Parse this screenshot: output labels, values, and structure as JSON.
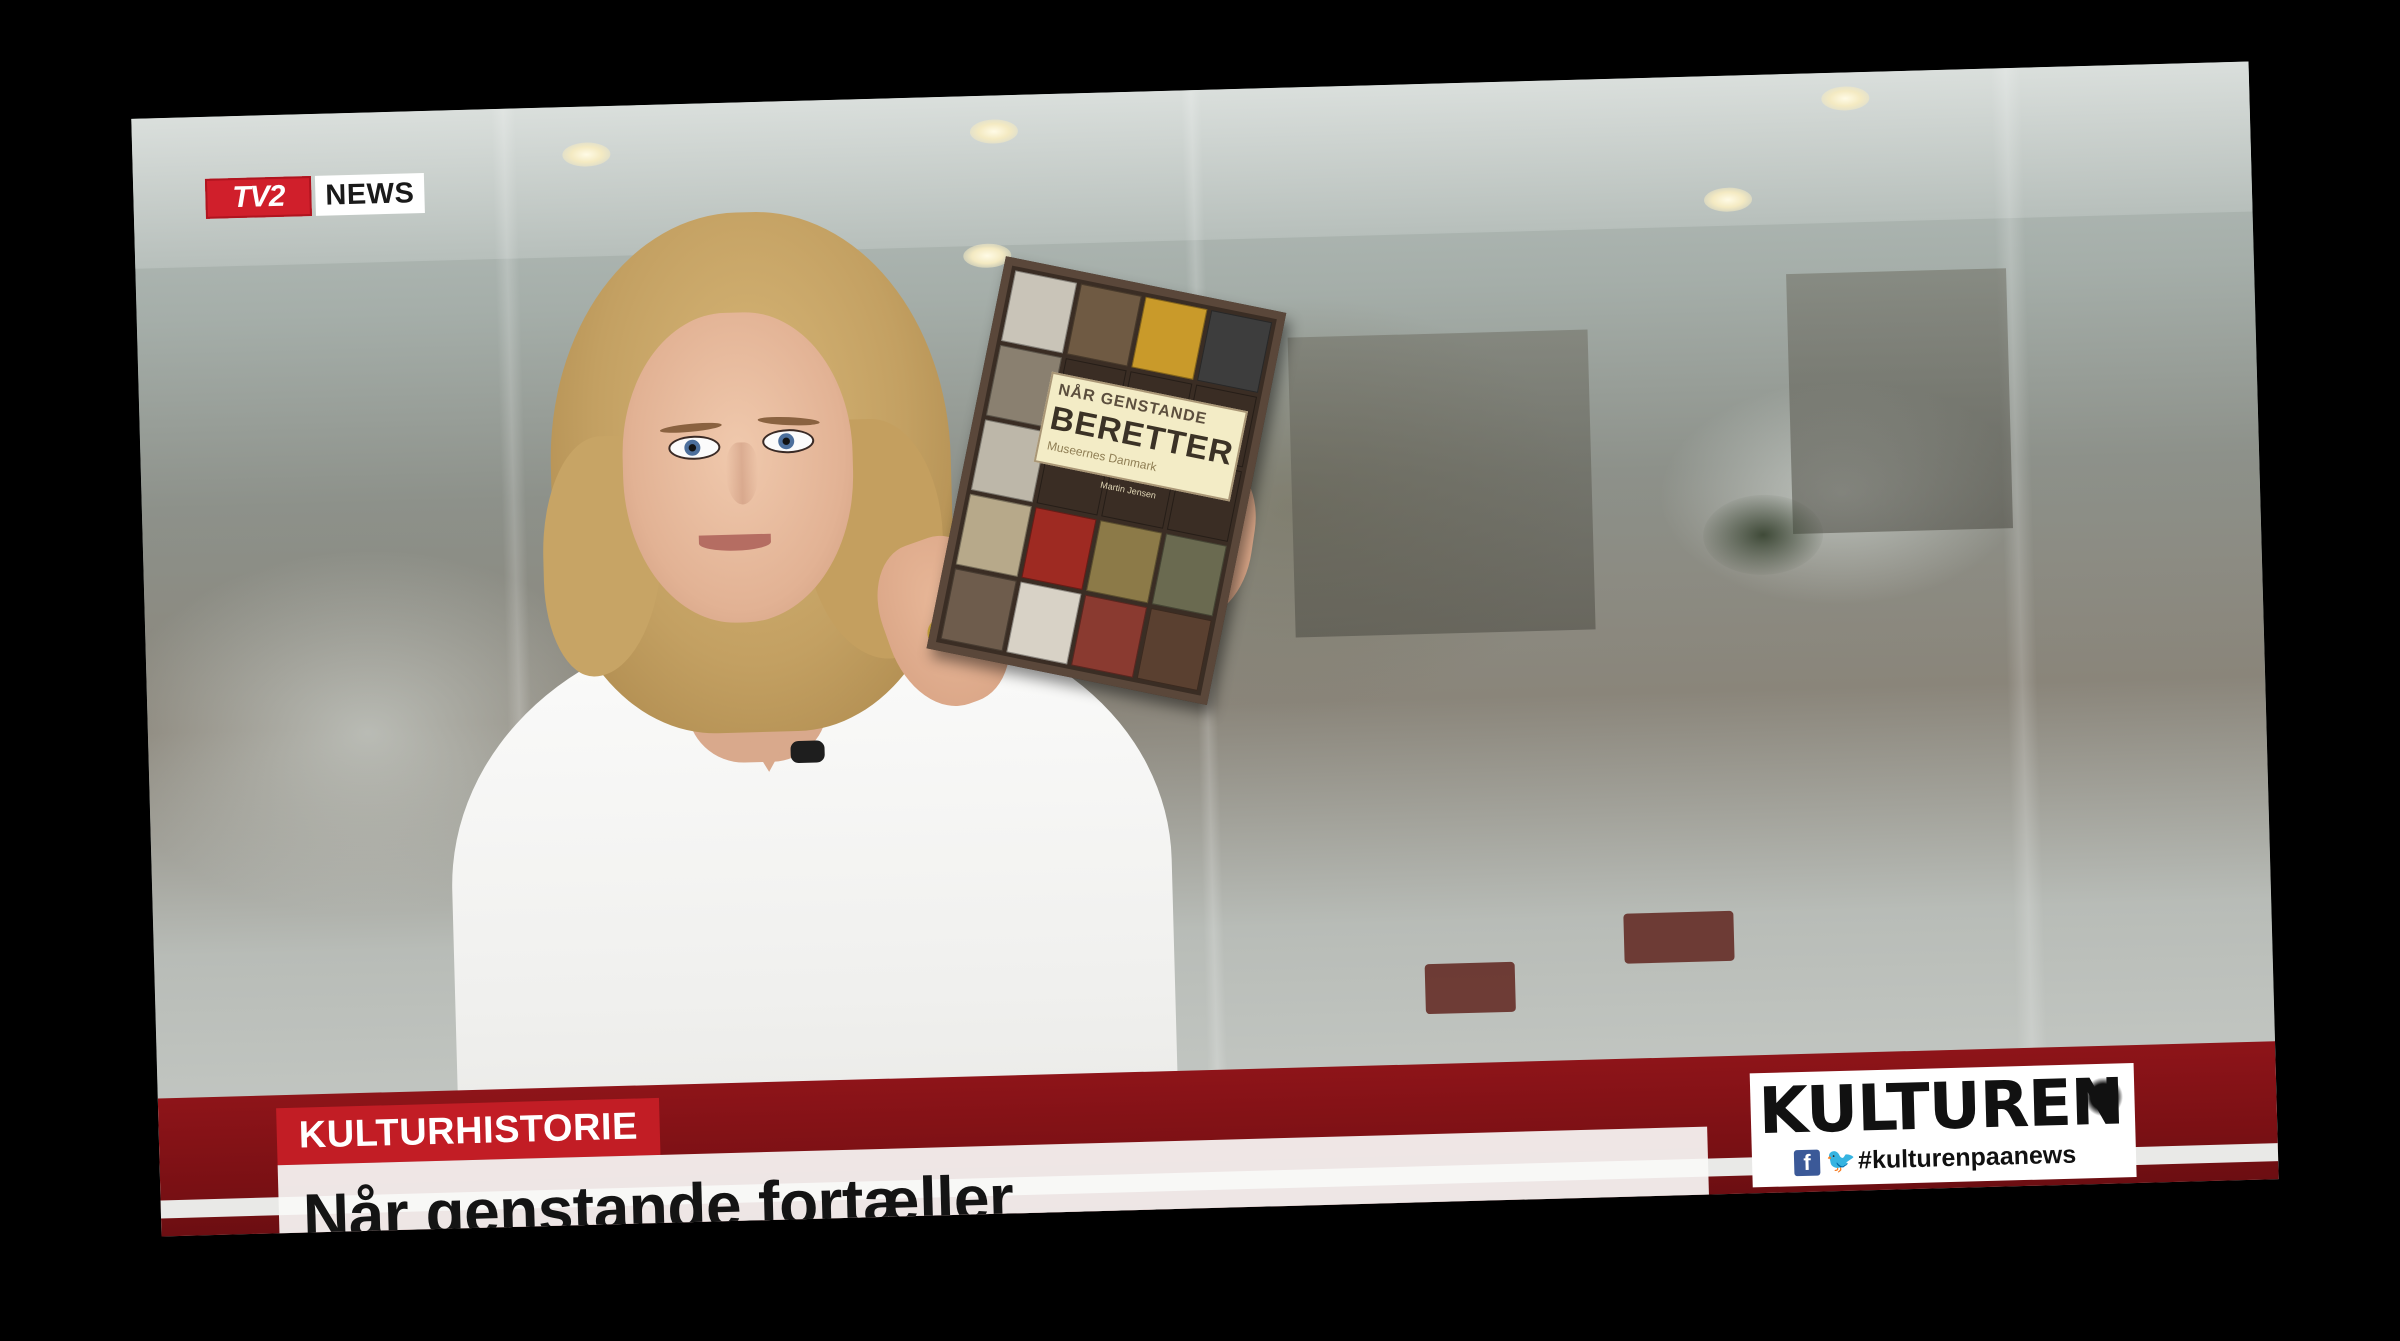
{
  "broadcast": {
    "logo": {
      "channel": "TV2",
      "label": "NEWS"
    },
    "lower_third": {
      "category": "KULTURHISTORIE",
      "headline": "Når genstande fortæller"
    },
    "segment_badge": {
      "title": "KULTUREN",
      "hashtag": "#kulturenpaanews",
      "icons": [
        "facebook-icon",
        "twitter-icon"
      ]
    }
  },
  "book": {
    "title_small": "NÅR GENSTANDE",
    "title_big": "BERETTER",
    "subtitle": "Museernes Danmark",
    "author": "Martin Jensen"
  },
  "colors": {
    "tv2_red": "#d01f2b",
    "category_red": "#c21d25",
    "band_red": "#8e1419"
  }
}
